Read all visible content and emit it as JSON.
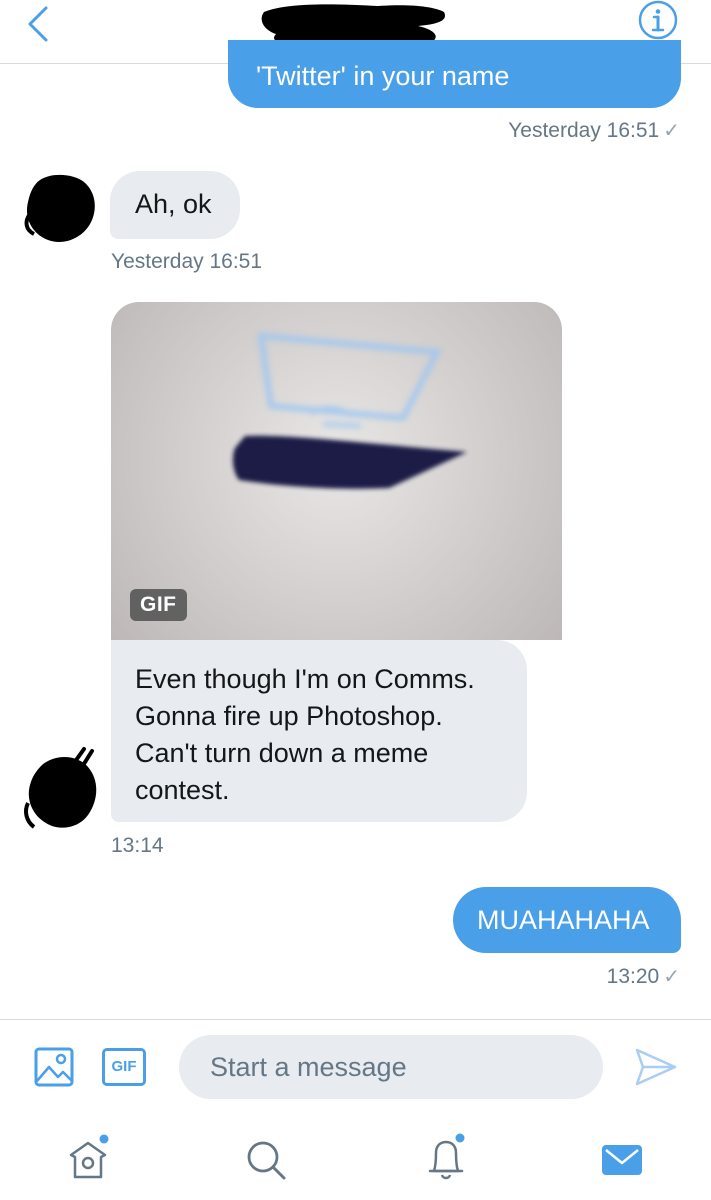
{
  "header": {
    "back_icon": "chevron-left-icon",
    "info_icon": "info-circle-icon"
  },
  "messages": [
    {
      "direction": "outgoing",
      "text": "'Twitter' in your name",
      "timestamp": "Yesterday 16:51",
      "status": "✓"
    },
    {
      "direction": "incoming",
      "text": "Ah, ok",
      "timestamp": "Yesterday 16:51"
    },
    {
      "direction": "incoming",
      "media": "gif",
      "badge": "GIF",
      "lines": [
        "Even though I'm on Comms.",
        "Gonna fire up Photoshop.",
        "Can't turn down a meme",
        "contest."
      ],
      "timestamp": "13:14"
    },
    {
      "direction": "outgoing",
      "text": "MUAHAHAHA",
      "timestamp": "13:20",
      "status": "✓"
    }
  ],
  "composer": {
    "gif_label": "GIF",
    "placeholder": "Start a message"
  },
  "tabbar": [
    "home-icon",
    "search-icon",
    "notifications-icon",
    "messages-icon"
  ],
  "colors": {
    "accent": "#4a9fe9",
    "incoming_bubble": "#e8ebef",
    "timestamp": "#657786"
  }
}
